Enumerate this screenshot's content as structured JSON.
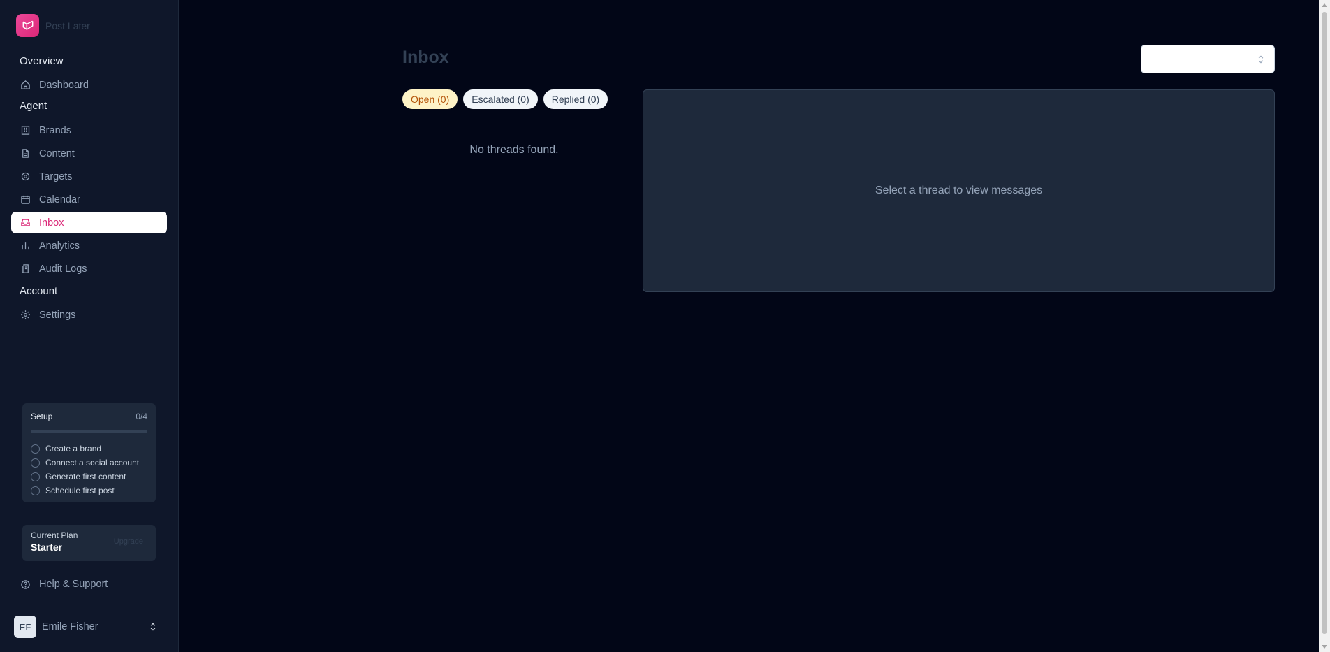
{
  "app": {
    "name": "Post Later"
  },
  "sidebar": {
    "sections": [
      {
        "label": "Overview"
      },
      {
        "label": "Agent"
      },
      {
        "label": "Account"
      }
    ],
    "items": [
      {
        "label": "Dashboard",
        "icon": "home-icon"
      },
      {
        "label": "Brands",
        "icon": "building-icon"
      },
      {
        "label": "Content",
        "icon": "file-icon"
      },
      {
        "label": "Targets",
        "icon": "target-icon"
      },
      {
        "label": "Calendar",
        "icon": "calendar-icon"
      },
      {
        "label": "Inbox",
        "icon": "inbox-icon",
        "active": true
      },
      {
        "label": "Analytics",
        "icon": "bar-chart-icon"
      },
      {
        "label": "Audit Logs",
        "icon": "logs-icon"
      },
      {
        "label": "Settings",
        "icon": "gear-icon"
      }
    ],
    "setup": {
      "title": "Setup",
      "count": "0/4",
      "progress": 0,
      "steps": [
        "Create a brand",
        "Connect a social account",
        "Generate first content",
        "Schedule first post"
      ]
    },
    "plan": {
      "label": "Current Plan",
      "name": "Starter",
      "upgrade": "Upgrade"
    },
    "help": "Help & Support",
    "user": {
      "initials": "EF",
      "name": "Emile Fisher"
    }
  },
  "main": {
    "title": "Inbox",
    "brand_select": {
      "value": ""
    },
    "tabs": [
      {
        "label": "Open (0)",
        "active": true
      },
      {
        "label": "Escalated (0)"
      },
      {
        "label": "Replied (0)"
      }
    ],
    "empty_list": "No threads found.",
    "thread_placeholder": "Select a thread to view messages"
  },
  "colors": {
    "accent": "#db2777",
    "background": "#020617",
    "sidebar": "#0f172a",
    "active_tab": "#fef3c7"
  }
}
